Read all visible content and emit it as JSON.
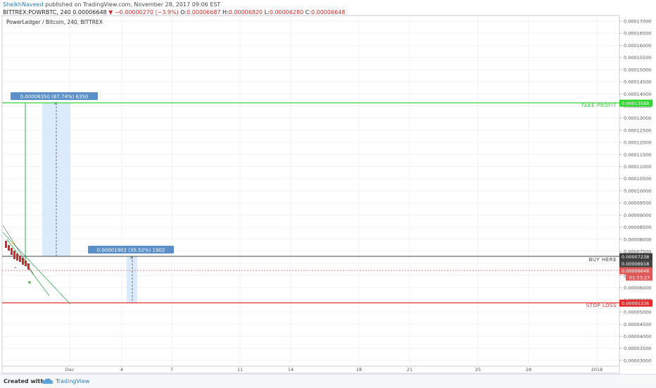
{
  "header": {
    "author": "SheikhNaveed",
    "published_text": "published on TradingView.com, November 28, 2017 09:06 EST",
    "symbol": "BITTREX:POWRBTC, 240",
    "last": "0.00006648",
    "change": "▼ −0.00000270 (−3.9%)",
    "o_label": "O:",
    "o_value": "0.00006687",
    "h_label": "H:",
    "h_value": "0.00006820",
    "l_label": "L:",
    "l_value": "0.00006280",
    "c_label": "C:",
    "c_value": "0.00006648"
  },
  "chart_title": "PowerLedger / Bitcoin, 240, BITTREX",
  "y_ticks": [
    "0.00017000",
    "0.00016500",
    "0.00016000",
    "0.00015500",
    "0.00015000",
    "0.00014500",
    "0.00014000",
    "0.00013500",
    "0.00013000",
    "0.00012500",
    "0.00012000",
    "0.00011500",
    "0.00011000",
    "0.00010500",
    "0.00010000",
    "0.00009500",
    "0.00009000",
    "0.00008500",
    "0.00008000",
    "0.00007500",
    "0.00007000",
    "0.00006500",
    "0.00006000",
    "0.00005500",
    "0.00005000",
    "0.00004500",
    "0.00004000",
    "0.00003500",
    "0.00003000"
  ],
  "x_ticks": [
    "Dec",
    "4",
    "7",
    "11",
    "14",
    "18",
    "21",
    "25",
    "28",
    "2018"
  ],
  "lines": {
    "take_profit": {
      "label": "TAKE PROFIT",
      "price": "0.00013588",
      "color": "#33d433"
    },
    "buy_here": {
      "label": "BUY HERE",
      "price": "0.00007238",
      "color": "#444444"
    },
    "stop_loss": {
      "label": "STOP LOSS",
      "price": "0.00005336",
      "color": "#e22a2a"
    }
  },
  "price_labels": {
    "p1": "0.00006918",
    "current": "0.00006648",
    "countdown": "01:53:27"
  },
  "measures": {
    "m1": "0.00006350 (87.74%) 6350",
    "m2": "0.00001902 (35.52%) 1902"
  },
  "colors": {
    "up": "#3aa853",
    "down": "#d22a2a",
    "measure_bg": "#5b8fc7",
    "range_fill": "#d6e8fb"
  },
  "footer": {
    "created": "Created with",
    "brand": "TradingView"
  }
}
